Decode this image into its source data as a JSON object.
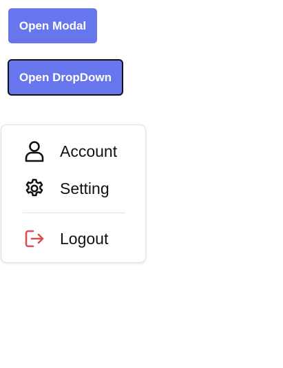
{
  "buttons": {
    "open_modal": "Open Modal",
    "open_dropdown": "Open DropDown"
  },
  "dropdown": {
    "items": [
      {
        "label": "Account",
        "icon": "user-icon"
      },
      {
        "label": "Setting",
        "icon": "gear-icon"
      },
      {
        "label": "Logout",
        "icon": "logout-icon"
      }
    ]
  },
  "colors": {
    "button_bg": "#6776ec",
    "button_text": "#ffffff",
    "logout_icon": "#e04a4a",
    "text": "#111111"
  }
}
